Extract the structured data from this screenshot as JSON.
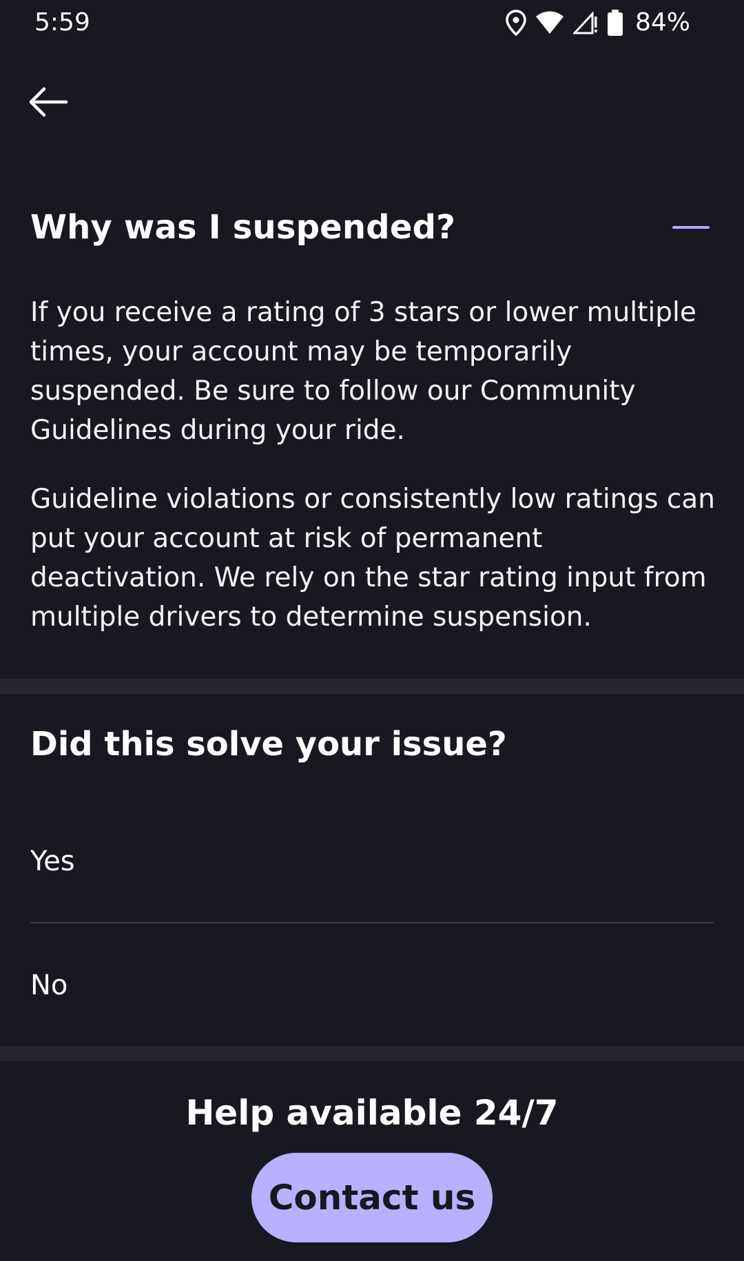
{
  "status_bar": {
    "time": "5:59",
    "battery": "84%",
    "icons": [
      "location-icon",
      "wifi-icon",
      "signal-icon",
      "battery-icon"
    ]
  },
  "nav": {
    "back_icon": "arrow-left-icon"
  },
  "faq": {
    "title": "Why was I suspended?",
    "expanded": true,
    "collapse_icon": "minus-icon",
    "accent_color": "#b9a8ff",
    "paragraphs": [
      "If you receive a rating of 3 stars or lower multiple times, your account may be temporarily suspended. Be sure to follow our Community Guidelines during your ride.",
      "Guideline violations or consistently low ratings can put your account at risk of permanent deactivation. We rely on the star rating input from multiple drivers to determine suspension."
    ]
  },
  "feedback": {
    "question": "Did this solve your issue?",
    "options": [
      "Yes",
      "No"
    ]
  },
  "help": {
    "title": "Help available 24/7",
    "contact_label": "Contact us",
    "button_color": "#b9b0ff"
  },
  "theme": {
    "background": "#181920",
    "divider": "#25262d"
  }
}
